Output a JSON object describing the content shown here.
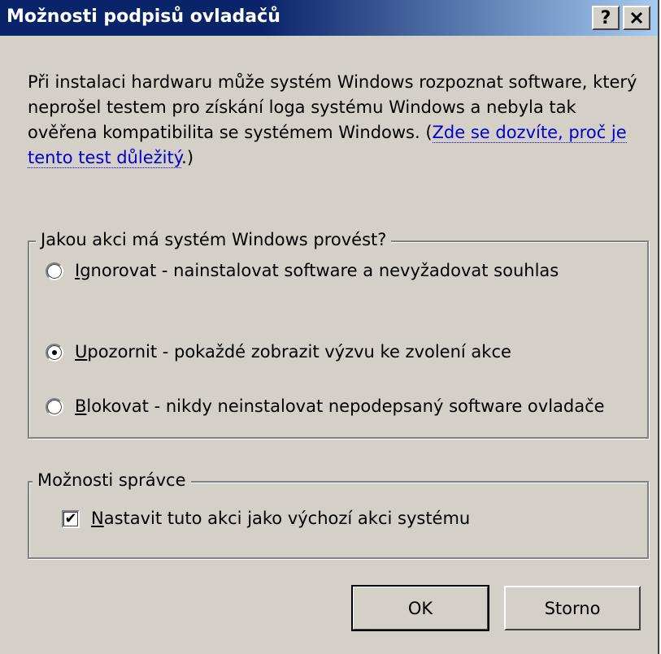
{
  "window": {
    "title": "Možnosti podpisů ovladačů",
    "help_label": "?",
    "close_label": "✕"
  },
  "description": {
    "text": "Při instalaci hardwaru může systém Windows rozpoznat software, který neprošel testem pro získání loga systému Windows a nebyla tak ověřena kompatibilita se systémem Windows. (",
    "link": "Zde se dozvíte, proč je tento test důležitý",
    "tail": ".)"
  },
  "action_group": {
    "legend": "Jakou akci má systém Windows provést?",
    "options": [
      {
        "key": "I",
        "rest": "gnorovat - nainstalovat software a nevyžadovat souhlas",
        "checked": false
      },
      {
        "key": "U",
        "rest": "pozornit - pokaždé zobrazit výzvu ke zvolení akce",
        "checked": true
      },
      {
        "key": "B",
        "rest": "lokovat - nikdy neinstalovat nepodepsaný software ovladače",
        "checked": false
      }
    ]
  },
  "admin_group": {
    "legend": "Možnosti správce",
    "checkbox_key": "N",
    "checkbox_rest": "astavit tuto akci jako výchozí akci systému",
    "checked": true
  },
  "buttons": {
    "ok": "OK",
    "cancel": "Storno"
  }
}
